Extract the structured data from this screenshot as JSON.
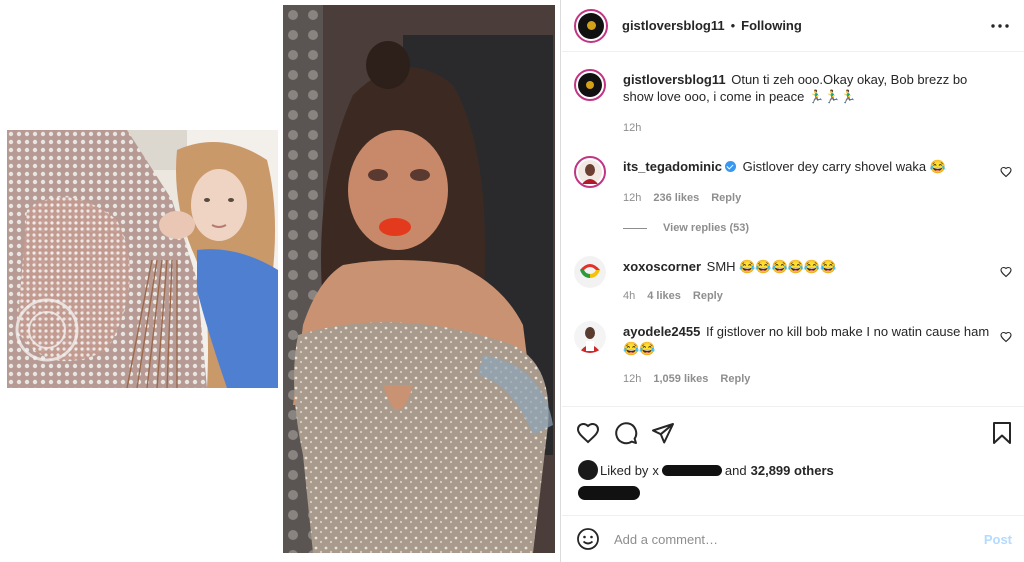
{
  "header": {
    "username": "gistloversblog11",
    "separator": "•",
    "follow_state": "Following"
  },
  "caption": {
    "username": "gistloversblog11",
    "text": "Otun ti zeh ooo.Okay okay, Bob brezz bo show love ooo, i come in peace 🏃‍♂️🏃‍♂️🏃‍♂️",
    "time": "12h"
  },
  "comments": [
    {
      "username": "its_tegadominic",
      "verified": true,
      "text": "Gistlover dey carry shovel waka 😂",
      "time": "12h",
      "likes": "236 likes",
      "reply": "Reply"
    },
    {
      "username": "xoxoscorner",
      "verified": false,
      "text": "SMH 😂😂😂😂😂😂",
      "time": "4h",
      "likes": "4 likes",
      "reply": "Reply"
    },
    {
      "username": "ayodele2455",
      "verified": false,
      "text": "If gistlover no kill bob make I no watin cause ham 😂😂",
      "time": "12h",
      "likes": "1,059 likes",
      "reply": "Reply"
    }
  ],
  "view_replies": "View replies (53)",
  "likes": {
    "prefix": "Liked by",
    "redacted_user": "x",
    "suffix": "and",
    "others": "32,899 others"
  },
  "add_comment": {
    "placeholder": "Add a comment…",
    "post_label": "Post"
  },
  "colors": {
    "story_ring": "#c13584",
    "verified": "#3897f0",
    "post_disabled": "#b3dbff",
    "muted": "#8e8e8e"
  },
  "icons": [
    "more-icon",
    "heart-icon",
    "comment-icon",
    "share-icon",
    "bookmark-icon",
    "emoji-icon"
  ]
}
